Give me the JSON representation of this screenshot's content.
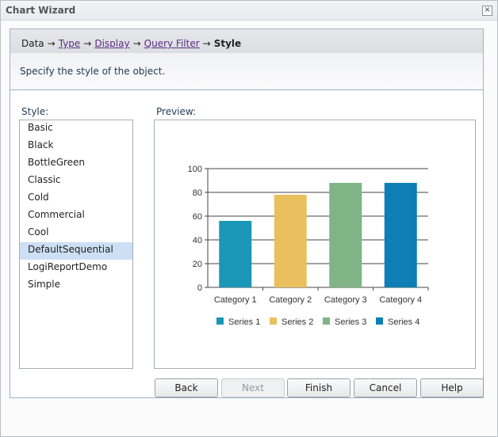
{
  "window": {
    "title": "Chart Wizard"
  },
  "steps": [
    {
      "label": "Data",
      "link": false,
      "current": false
    },
    {
      "label": "Type",
      "link": true,
      "current": false
    },
    {
      "label": "Display",
      "link": true,
      "current": false
    },
    {
      "label": "Query Filter",
      "link": true,
      "current": false
    },
    {
      "label": "Style",
      "link": false,
      "current": true
    }
  ],
  "step_arrow": "→",
  "description": "Specify the style of the object.",
  "style_label": "Style:",
  "preview_label": "Preview:",
  "styles": [
    "Basic",
    "Black",
    "BottleGreen",
    "Classic",
    "Cold",
    "Commercial",
    "Cool",
    "DefaultSequential",
    "LogiReportDemo",
    "Simple"
  ],
  "selected_style": "DefaultSequential",
  "buttons": {
    "back": "Back",
    "next": "Next",
    "finish": "Finish",
    "cancel": "Cancel",
    "help": "Help"
  },
  "chart_data": {
    "type": "bar",
    "categories": [
      "Category 1",
      "Category 2",
      "Category 3",
      "Category 4"
    ],
    "series": [
      {
        "name": "Series 1",
        "color": "#1a97b6",
        "values": [
          56,
          0,
          0,
          0
        ]
      },
      {
        "name": "Series 2",
        "color": "#eac05f",
        "values": [
          0,
          78,
          0,
          0
        ]
      },
      {
        "name": "Series 3",
        "color": "#80b486",
        "values": [
          0,
          0,
          88,
          0
        ]
      },
      {
        "name": "Series 4",
        "color": "#0e7fb5",
        "values": [
          0,
          0,
          0,
          88
        ]
      }
    ],
    "ylim": [
      0,
      100
    ],
    "yticks": [
      0,
      20,
      40,
      60,
      80,
      100
    ],
    "grid": true,
    "legend": "bottom"
  }
}
